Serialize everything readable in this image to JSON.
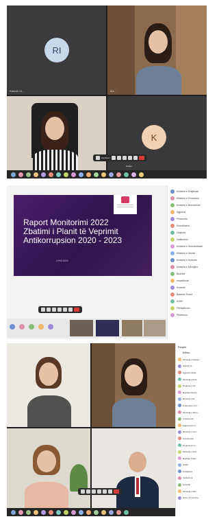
{
  "panel1": {
    "tiles": [
      {
        "initials": "RI",
        "nameplate": "Kamzë Lit..."
      },
      {
        "nameplate": "Ma..."
      },
      {
        "nameplate": ""
      },
      {
        "initials": "K",
        "nameplate": ""
      }
    ],
    "toolbar": {
      "label": "Vendosur",
      "label2": "Ndarje"
    }
  },
  "panel2": {
    "slide": {
      "title_line1": "Raport Monitorimi 2022",
      "title_line2": "Zbatimi i Planit të Veprimit",
      "title_line3": "Antikorrupsion 2020 - 2023",
      "date": "4 Prill 2023"
    },
    "participants": [
      "Ministria e Drejtësisë",
      "Ministria e Financave",
      "Ministria e Brendshme",
      "Agjencia",
      "Prokuroria",
      "Koordinatori",
      "Drejtoria",
      "Institucioni",
      "Ministria e Shëndetësisë",
      "Ministria e Arsimit",
      "Ministria e Kulturës",
      "Ministria e Mbrojtjes",
      "Bashkia",
      "Inspektorati",
      "Kontrolli",
      "Bashkia Tiranë",
      "ASHK",
      "Përfaqësues",
      "Prefektura"
    ]
  },
  "panel3": {
    "participants_title": "People",
    "participants_sub": "Kërko",
    "participants": [
      "Ministria e Drejtës...",
      "Kamzë Lit...",
      "Agjencia Shtet...",
      "Ministria e Fina...",
      "Drejtoria e Pa...",
      "Bashkia Durrës",
      "Ministria e Br...",
      "Prokuroria e Ps...",
      "Ministria e Shën...",
      "Inspektorati",
      "Agjencia Kom...",
      "Ministria e Arsi...",
      "Koordinatori",
      "Drejtoria Kom...",
      "Ministria e Kult...",
      "Bashkia Tiranë",
      "ASHK",
      "Prefektura",
      "Institucioni",
      "Kontrolli",
      "Ministria e Mbr...",
      "Zyra e Kryeminis..."
    ]
  },
  "colors": {
    "accent": "#d83b3b",
    "slide": "#3c1a5b",
    "avatar_blue": "#c8d7ea",
    "avatar_peach": "#f2d1b3"
  }
}
